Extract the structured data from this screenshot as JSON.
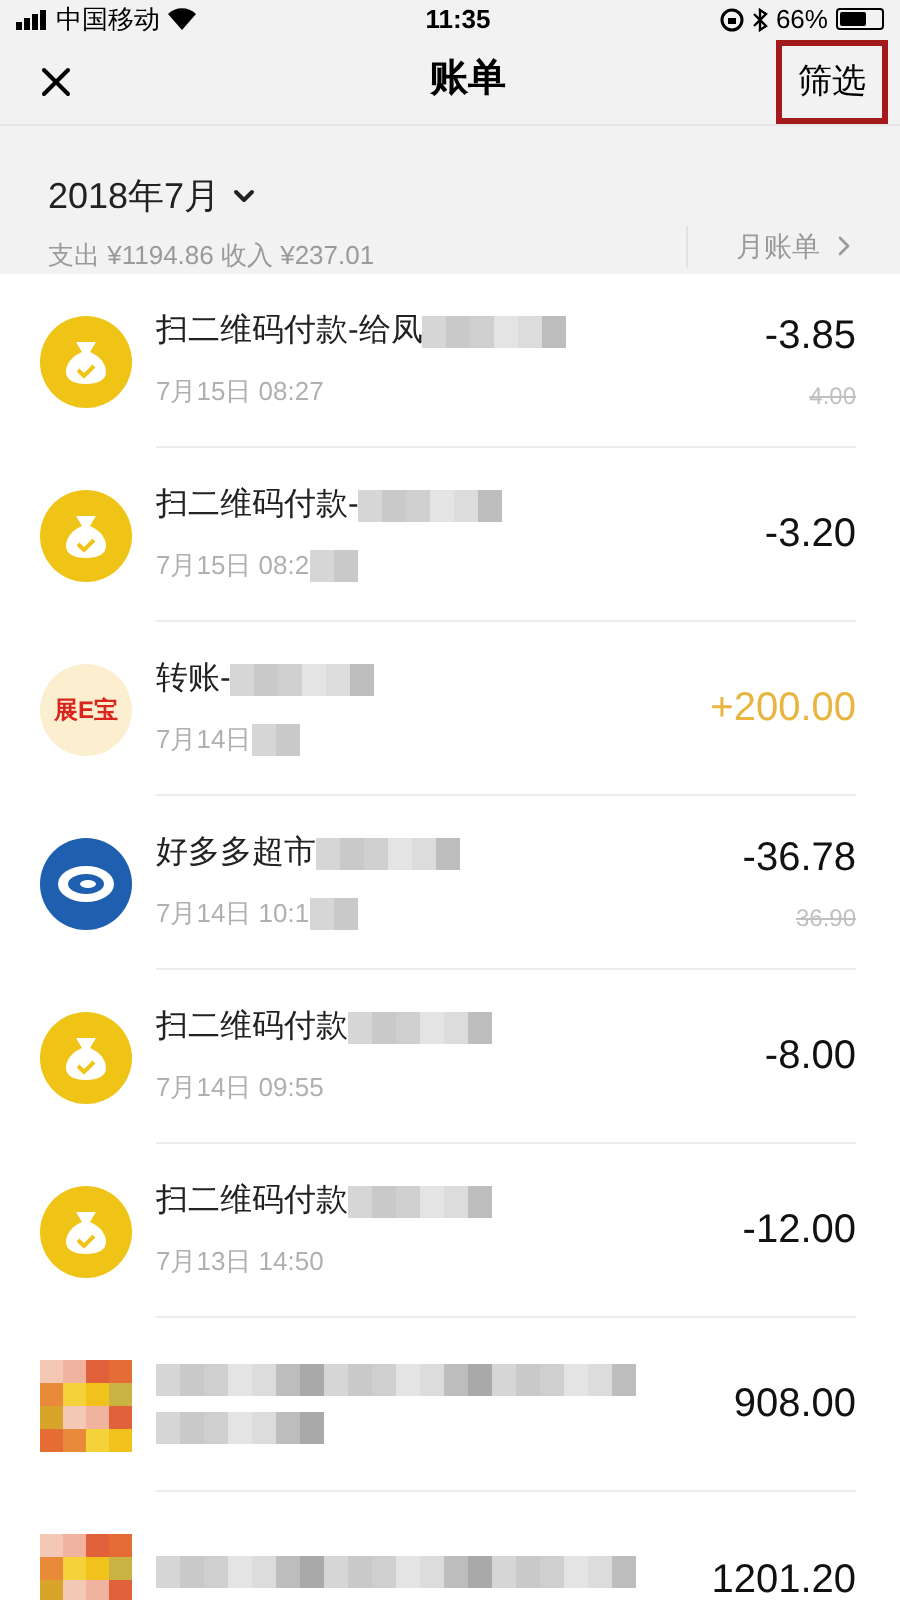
{
  "status_bar": {
    "carrier": "中国移动",
    "time": "11:35",
    "battery": "66%"
  },
  "nav": {
    "title": "账单",
    "filter": "筛选",
    "filter_highlighted": true
  },
  "summary": {
    "month": "2018年7月",
    "totals": "支出 ¥1194.86 收入 ¥237.01",
    "monthly_bill": "月账单"
  },
  "rows": [
    {
      "icon": {
        "kind": "bag"
      },
      "title": "扫二维码付款-给凤",
      "title_redacted": true,
      "date": "7月15日 08:27",
      "date_redacted": false,
      "amount": "-3.85",
      "income": false,
      "original": "4.00"
    },
    {
      "icon": {
        "kind": "bag"
      },
      "title": "扫二维码付款-",
      "title_redacted": true,
      "date": "7月15日 08:2",
      "date_redacted": true,
      "amount": "-3.20",
      "income": false
    },
    {
      "icon": {
        "kind": "badge",
        "text": "展E宝"
      },
      "title": "转账-",
      "title_redacted": true,
      "date": "7月14日",
      "date_redacted": true,
      "amount": "+200.00",
      "income": true
    },
    {
      "icon": {
        "kind": "swirl"
      },
      "title": "好多多超市",
      "title_redacted": true,
      "date": "7月14日 10:1",
      "date_redacted": true,
      "amount": "-36.78",
      "income": false,
      "original": "36.90"
    },
    {
      "icon": {
        "kind": "bag"
      },
      "title": "扫二维码付款",
      "title_redacted": true,
      "date": "7月14日 09:55",
      "date_redacted": false,
      "amount": "-8.00",
      "income": false
    },
    {
      "icon": {
        "kind": "bag"
      },
      "title": "扫二维码付款",
      "title_redacted": true,
      "date": "7月13日 14:50",
      "date_redacted": false,
      "amount": "-12.00",
      "income": false
    },
    {
      "icon": {
        "kind": "mosaic"
      },
      "title_redacted": true,
      "date_redacted": true,
      "amount": "908.00",
      "income": false
    },
    {
      "icon": {
        "kind": "mosaic"
      },
      "title_redacted": true,
      "date_redacted": false,
      "amount": "1201.20",
      "income": false
    }
  ]
}
